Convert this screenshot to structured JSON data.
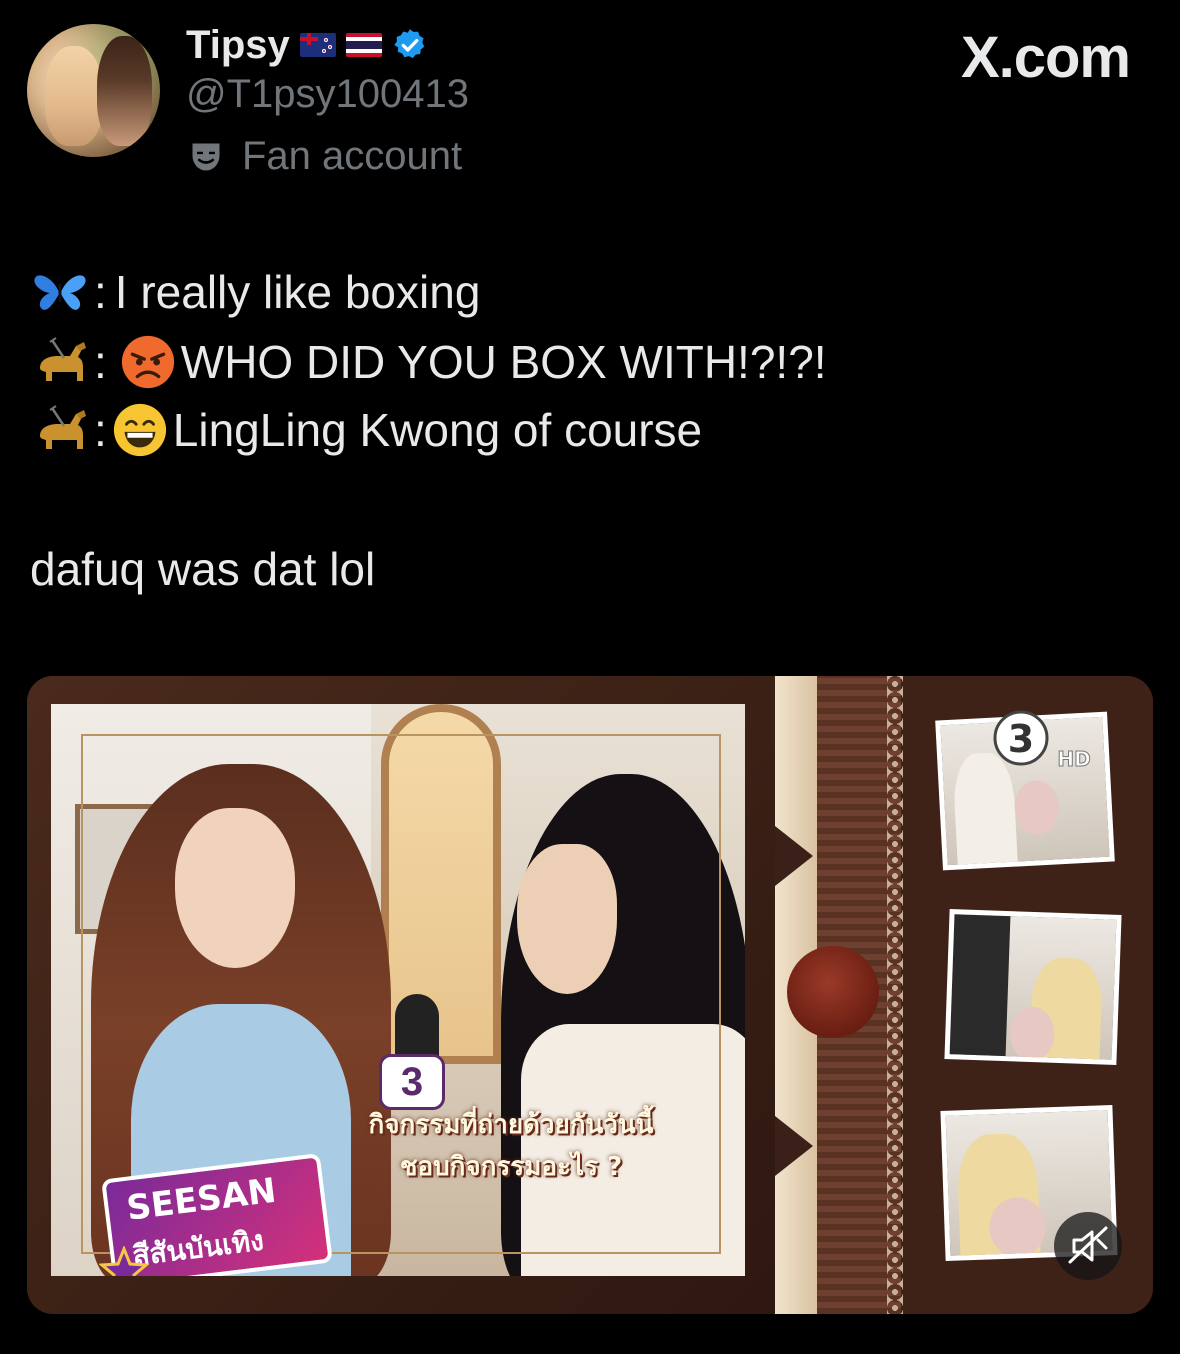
{
  "header": {
    "display_name": "Tipsy",
    "flags": [
      "new-zealand-flag",
      "thailand-flag"
    ],
    "verified_icon": "verified-badge-icon",
    "handle": "@T1psy100413",
    "label_icon": "theater-mask-icon",
    "label_text": "Fan account",
    "site_watermark": "X.com"
  },
  "tweet": {
    "lines": [
      {
        "emoji": "butterfly",
        "prefix": ":",
        "text": "I really like boxing"
      },
      {
        "emoji": "guide-dog",
        "prefix": ":",
        "reaction": "angry-face",
        "text": "WHO DID YOU BOX WITH!?!?!"
      },
      {
        "emoji": "guide-dog",
        "prefix": ":",
        "reaction": "grinning-face",
        "text": "LingLing Kwong of course"
      }
    ],
    "comment": "dafuq was dat lol"
  },
  "media": {
    "channel_badge": "3",
    "channel_hd": "HD",
    "mic_badge": "3",
    "caption_line1": "กิจกรรมที่ถ่ายด้วยกันวันนี้",
    "caption_line2": "ชอบกิจกรรมอะไร ?",
    "show_logo_line1": "SEESAN",
    "show_logo_line2": "สีสันบันเทิง",
    "mute_icon": "speaker-muted-icon"
  },
  "colors": {
    "background": "#000000",
    "text_primary": "#e7e9ea",
    "text_secondary": "#71767b",
    "verified_blue": "#1d9bf0",
    "frame_brown": "#3a2018"
  }
}
